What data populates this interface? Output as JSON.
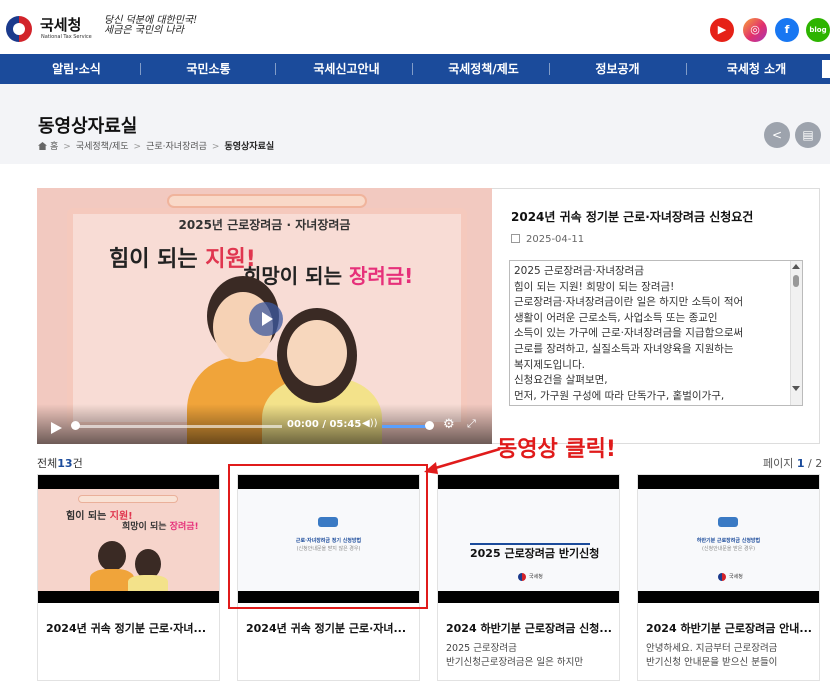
{
  "header": {
    "logo_text": "국세청",
    "logo_sub": "National Tax Service",
    "slogan_line1": "당신 덕분에 대한민국!",
    "slogan_line2": "세금은 국민의 나라",
    "sns": [
      "youtube-icon",
      "instagram-icon",
      "facebook-icon",
      "blog-icon"
    ],
    "sns_labels": {
      "youtube": "▶",
      "instagram": "◎",
      "facebook": "f",
      "blog": "blog"
    }
  },
  "nav": {
    "items": [
      "알림·소식",
      "국민소통",
      "국세신고안내",
      "국세정책/제도",
      "정보공개",
      "국세청 소개"
    ]
  },
  "page": {
    "title": "동영상자료실",
    "breadcrumb": [
      "홈",
      "국세정책/제도",
      "근로·자녀장려금",
      "동영상자료실"
    ],
    "share_icon": "share-icon",
    "print_icon": "print-icon",
    "share_glyph": "<",
    "print_glyph": "▤"
  },
  "feature": {
    "title": "2024년 귀속 정기분 근로·자녀장려금 신청요건",
    "date": "2025-04-11",
    "video": {
      "subtitle": "2025년 근로장려금 · 자녀장려금",
      "headline1_a": "힘이 되는 ",
      "headline1_b": "지원!",
      "headline2_a": "희망이 되는 ",
      "headline2_b": "장려금!",
      "time": "00:00 / 05:45",
      "progress": 0,
      "volume": 0.85,
      "volume_glyph": "◀))",
      "settings_glyph": "⚙",
      "fullscreen_glyph": "⤢"
    },
    "description": "2025 근로장려금·자녀장려금\n힘이 되는 지원! 희망이 되는 장려금!\n근로장려금·자녀장려금이란 일은 하지만 소득이 적어\n생활이 어려운 근로소득, 사업소득 또는 종교인\n소득이 있는 가구에 근로·자녀장려금을 지급함으로써\n근로를 장려하고, 실질소득과 자녀양육을 지원하는\n복지제도입니다.\n신청요건을 살펴보면,\n먼저, 가구원 구성에 따라 단독가구, 홑벌이가구,\n맞벌이 가구 중 어떤 가구에 해당되는 지 확인합니다."
  },
  "list": {
    "total_label": "전체",
    "total_count": "13",
    "total_unit": "건",
    "page_label": "페이지",
    "page_current": "1",
    "page_sep": " / ",
    "page_total": "2",
    "annotation": "동영상 클릭!",
    "cards": [
      {
        "title": "2024년 귀속 정기분 근로·자녀...",
        "desc": ""
      },
      {
        "title": "2024년 귀속 정기분 근로·자녀...",
        "desc": "",
        "thumb_text": "근로·자녀장려금 정기 신청방법",
        "thumb_sub": "(신청안내문을 받지 않은 경우)"
      },
      {
        "title": "2024 하반기분 근로장려금 신청...",
        "desc": "2025 근로장려금\n반기신청근로장려금은 일은 하지만",
        "thumb_text": "2025 근로장려금 반기신청",
        "thumb_year": "2025"
      },
      {
        "title": "2024 하반기분 근로장려금 안내...",
        "desc": "안녕하세요. 지금부터 근로장려금\n반기신청 안내문을 받으신 분들이",
        "thumb_text": "하반기분 근로장려금 신청방법",
        "thumb_sub": "(신청안내문을 받은 경우)"
      }
    ],
    "thumb_logo": "국세청"
  }
}
